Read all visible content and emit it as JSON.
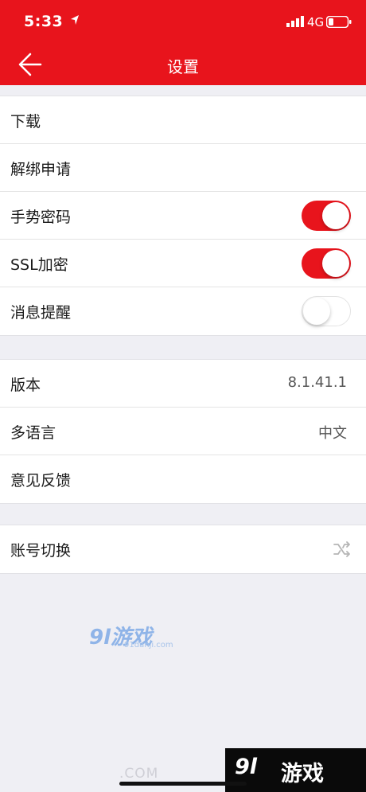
{
  "status_bar": {
    "time": "5:33",
    "network": "4G"
  },
  "nav": {
    "title": "设置"
  },
  "group1": [
    {
      "label": "下载"
    },
    {
      "label": "解绑申请"
    },
    {
      "label": "手势密码",
      "toggle": "on"
    },
    {
      "label": "SSL加密",
      "toggle": "on"
    },
    {
      "label": "消息提醒",
      "toggle": "off"
    }
  ],
  "group2": [
    {
      "label": "版本",
      "value": "8.1.41.1"
    },
    {
      "label": "多语言",
      "value": "中文"
    },
    {
      "label": "意见反馈"
    }
  ],
  "group3": [
    {
      "label": "账号切换",
      "icon": "shuffle-icon"
    }
  ],
  "watermark": {
    "logo": "9l游戏",
    "site": "91danji.com"
  },
  "corner_badge": {
    "logo": "9l",
    "text": "游戏"
  },
  "bottom_url": ".COM",
  "colors": {
    "accent": "#e8141c",
    "background": "#efeff4"
  }
}
